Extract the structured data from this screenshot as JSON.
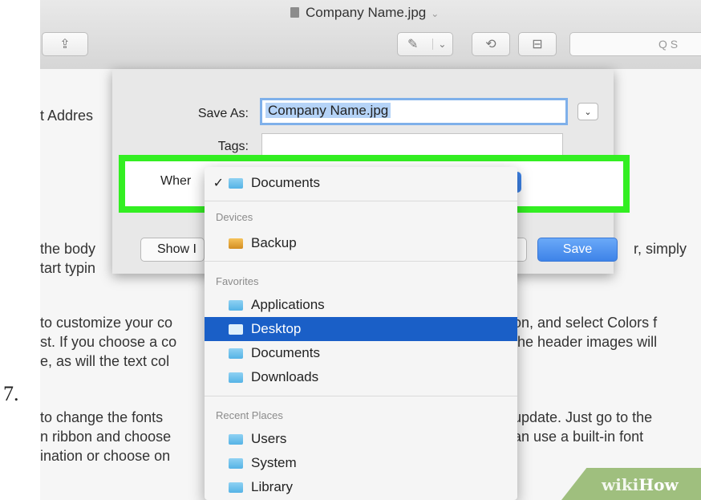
{
  "step_number": "7.",
  "window": {
    "title": "Company Name.jpg",
    "title_chevron": "⌄",
    "search_placeholder": "Q S"
  },
  "toolbar": {
    "share_icon": "share-icon",
    "markup_icon": "pen-icon",
    "markup_chevron": "⌄",
    "rotate_icon": "rotate-icon",
    "toolbox_icon": "toolbox-icon"
  },
  "document": {
    "lines": [
      "t Addres",
      "the body",
      "tart typin",
      "to customize your co",
      "st.  If you choose a co",
      "e, as will the text col",
      "to change the fonts",
      "n ribbon and choose",
      "ination or choose on"
    ],
    "right_lines": [
      "r, simply",
      "on, and select Colors f",
      "the header images will",
      "update.  Just go to the",
      "an use a built-in font"
    ]
  },
  "save_dialog": {
    "save_as_label": "Save As:",
    "save_as_value": "Company Name.jpg",
    "expand_chevron": "⌄",
    "tags_label": "Tags:",
    "tags_value": "",
    "where_label": "Wher",
    "show_button": "Show I",
    "save_button": "Save"
  },
  "location_menu": {
    "checked_item": "Documents",
    "check_mark": "✓",
    "sections": [
      {
        "header": "Devices",
        "items": [
          {
            "label": "Backup",
            "icon": "drive-icon"
          }
        ]
      },
      {
        "header": "Favorites",
        "items": [
          {
            "label": "Applications",
            "icon": "folder-icon"
          },
          {
            "label": "Desktop",
            "icon": "folder-icon",
            "highlighted": true
          },
          {
            "label": "Documents",
            "icon": "folder-icon"
          },
          {
            "label": "Downloads",
            "icon": "folder-icon"
          }
        ]
      },
      {
        "header": "Recent Places",
        "items": [
          {
            "label": "Users",
            "icon": "folder-icon"
          },
          {
            "label": "System",
            "icon": "folder-icon"
          },
          {
            "label": "Library",
            "icon": "folder-icon"
          }
        ]
      }
    ]
  },
  "watermark": {
    "wiki": "wiki",
    "how": "How"
  },
  "colors": {
    "highlight_green": "#33ef22",
    "selection_blue": "#1a5fc7",
    "save_blue": "#3e83e8"
  }
}
